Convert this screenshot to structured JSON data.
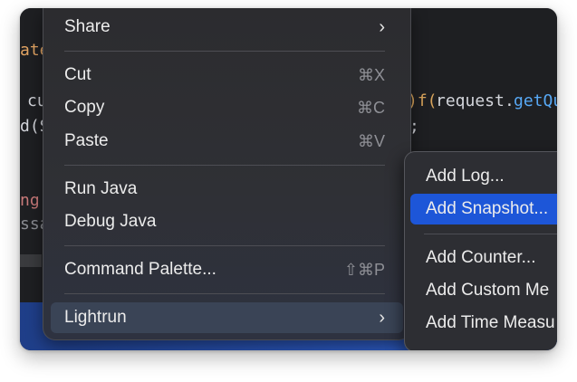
{
  "editor": {
    "fragments": [
      {
        "text": "ate",
        "color": "#e2a463"
      },
      {
        "text": "cu",
        "color": "#d3d5db"
      },
      {
        "text": "d(S",
        "color": "#d3d5db"
      },
      {
        "text": ")f(",
        "color": "#d7a35b"
      },
      {
        "text": "request",
        "color": "#d3d5db"
      },
      {
        "text": ".",
        "color": "#d3d5db"
      },
      {
        "text": "getQu",
        "color": "#57a8f5"
      },
      {
        "text": ";",
        "color": "#d3d5db"
      },
      {
        "text": "ng",
        "color": "#c97a7a"
      },
      {
        "text": "ssa",
        "color": "#8a8c92"
      }
    ]
  },
  "context_menu": {
    "share": {
      "label": "Share",
      "chevron": "›"
    },
    "cut": {
      "label": "Cut",
      "shortcut": "⌘X"
    },
    "copy": {
      "label": "Copy",
      "shortcut": "⌘C"
    },
    "paste": {
      "label": "Paste",
      "shortcut": "⌘V"
    },
    "run": {
      "label": "Run Java"
    },
    "debug": {
      "label": "Debug Java"
    },
    "palette": {
      "label": "Command Palette...",
      "shortcut": "⇧⌘P"
    },
    "lightrun": {
      "label": "Lightrun",
      "chevron": "›"
    }
  },
  "submenu": {
    "items": [
      {
        "label": "Add Log..."
      },
      {
        "label": "Add Snapshot..."
      },
      {
        "label": "Add Counter..."
      },
      {
        "label": "Add Custom Me"
      },
      {
        "label": "Add Time Measu"
      }
    ],
    "selected": "Add Snapshot..."
  },
  "colors": {
    "menu_bg": "#2e2f33",
    "selection_blue": "#1d56d8",
    "editor_bg": "#1e1f22",
    "bottom_band": "#2a55b8"
  }
}
